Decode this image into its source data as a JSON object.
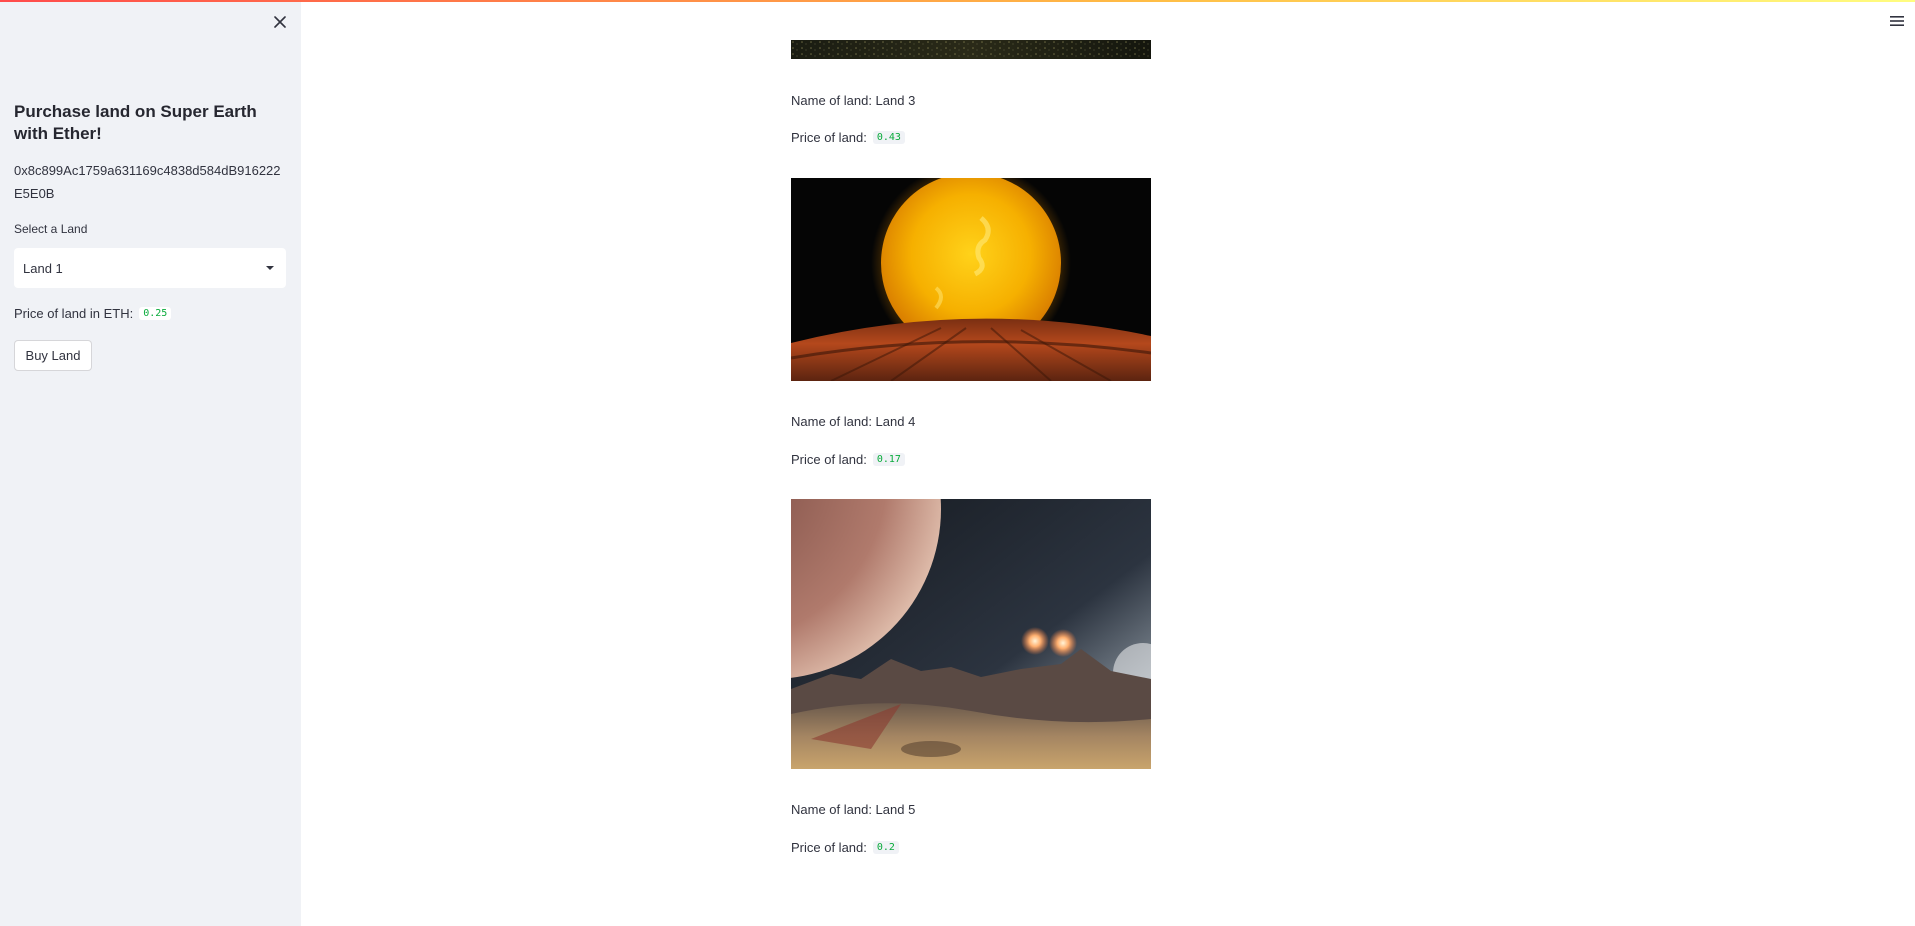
{
  "sidebar": {
    "title": "Purchase land on Super Earth with Ether!",
    "address": "0x8c899Ac1759a631169c4838d584dB916222E5E0B",
    "select_label": "Select a Land",
    "selected_land": "Land 1",
    "price_label": "Price of land in ETH:",
    "price_value": "0.25",
    "buy_button": "Buy Land"
  },
  "lands": [
    {
      "name": "Name of land: Land 3",
      "price_label": "Price of land:",
      "price": "0.43"
    },
    {
      "name": "Name of land: Land 4",
      "price_label": "Price of land:",
      "price": "0.17"
    },
    {
      "name": "Name of land: Land 5",
      "price_label": "Price of land:",
      "price": "0.2"
    }
  ],
  "icons": {
    "close": "close-icon",
    "menu": "hamburger-menu-icon",
    "dropdown": "chevron-down-icon"
  },
  "colors": {
    "accent_code": "#09ab3b",
    "sidebar_bg": "#f0f2f6",
    "text": "#31333f"
  }
}
